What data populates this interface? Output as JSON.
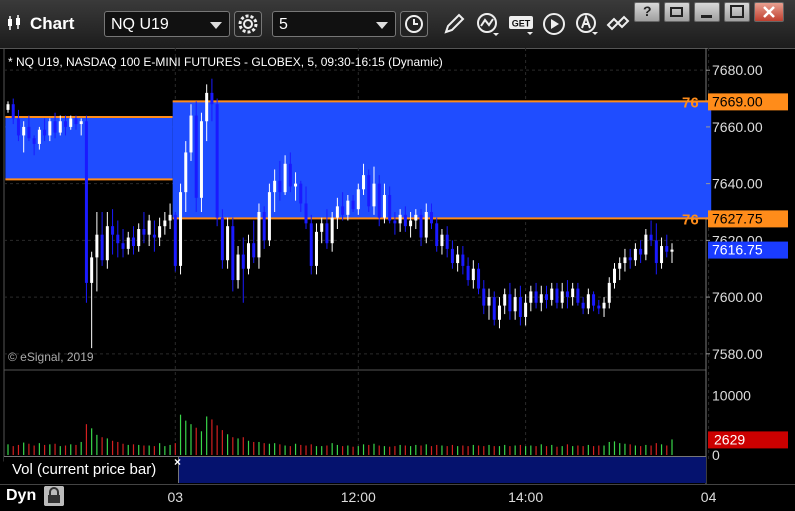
{
  "window": {
    "title": "Chart",
    "symbol_combo": "NQ U19",
    "interval_combo": "5",
    "buttons": [
      "clock-icon",
      "pencil-icon",
      "line-chart-icon",
      "get-icon",
      "play-icon",
      "alert-icon",
      "link-icon"
    ],
    "win_buttons": [
      "help",
      "restore",
      "maximize",
      "close"
    ],
    "help_label": "?"
  },
  "chart": {
    "symbol_line": "* NQ U19, NASDAQ 100 E-MINI FUTURES - GLOBEX, 5, 09:30-16:15 (Dynamic)",
    "copyright": "© eSignal, 2019",
    "dyn_label": "Dyn"
  },
  "volume": {
    "legend": "Vol (current price bar)",
    "close_glyph": "×"
  },
  "colors": {
    "zone": "#1f4dff",
    "zone_line": "#ff8c1a",
    "up": "#ffffff",
    "down": "#1a1aff",
    "vol_up": "#39d64a",
    "vol_down": "#d42020",
    "last_price_bg": "#1a3cff",
    "last_vol_bg": "#cc0000"
  },
  "chart_data": {
    "type": "candlestick",
    "price_axis": {
      "ylim": [
        7575,
        7685
      ],
      "ticks": [
        "7680.00",
        "7660.00",
        "7640.00",
        "7620.00",
        "7600.00",
        "7580.00"
      ],
      "labels": {
        "zone_upper": "7669.00",
        "zone_lower": "7627.75",
        "last": "7616.75",
        "zone_upper_left": "76",
        "zone_lower_left": "76"
      }
    },
    "volume_axis": {
      "ylim": [
        0,
        14000
      ],
      "ticks": [
        "10000",
        "0"
      ],
      "last_label": "2629"
    },
    "x_labels": [
      "03",
      "12:00",
      "14:00",
      "04"
    ],
    "zones": [
      {
        "from_bar": 0,
        "to_bar": 31,
        "top": 7663.5,
        "bottom": 7641.5
      },
      {
        "from_bar": 32,
        "to_bar": 134,
        "top": 7669.0,
        "bottom": 7627.75
      }
    ],
    "candles": [
      [
        7666,
        7669,
        7665,
        7668,
        1800
      ],
      [
        7668,
        7670,
        7661,
        7663,
        1500
      ],
      [
        7663,
        7666,
        7655,
        7657,
        1700
      ],
      [
        7657,
        7662,
        7651,
        7660,
        2100
      ],
      [
        7660,
        7664,
        7655,
        7656,
        1900
      ],
      [
        7656,
        7657,
        7650,
        7654,
        1600
      ],
      [
        7654,
        7660,
        7652,
        7659,
        2000
      ],
      [
        7659,
        7663,
        7655,
        7657,
        1700
      ],
      [
        7657,
        7663,
        7655,
        7662,
        1800
      ],
      [
        7662,
        7665,
        7656,
        7658,
        1900
      ],
      [
        7658,
        7664,
        7657,
        7662,
        1500
      ],
      [
        7662,
        7664,
        7657,
        7660,
        1600
      ],
      [
        7660,
        7664,
        7659,
        7663,
        1800
      ],
      [
        7663,
        7664,
        7659,
        7661,
        1700
      ],
      [
        7661,
        7663,
        7657,
        7662,
        2200
      ],
      [
        7662,
        7664,
        7598,
        7605,
        5200
      ],
      [
        7605,
        7616,
        7582,
        7614,
        4500
      ],
      [
        7614,
        7630,
        7602,
        7622,
        3400
      ],
      [
        7622,
        7630,
        7611,
        7613,
        3000
      ],
      [
        7613,
        7630,
        7610,
        7625,
        2800
      ],
      [
        7625,
        7631,
        7615,
        7622,
        2400
      ],
      [
        7622,
        7627,
        7614,
        7619,
        2200
      ],
      [
        7619,
        7624,
        7614,
        7617,
        1900
      ],
      [
        7617,
        7623,
        7615,
        7621,
        1700
      ],
      [
        7621,
        7625,
        7615,
        7618,
        1800
      ],
      [
        7618,
        7626,
        7616,
        7624,
        1700
      ],
      [
        7624,
        7630,
        7619,
        7622,
        1600
      ],
      [
        7622,
        7629,
        7618,
        7627,
        1600
      ],
      [
        7622,
        7627,
        7616,
        7621,
        1500
      ],
      [
        7621,
        7628,
        7618,
        7625,
        2000
      ],
      [
        7625,
        7630,
        7622,
        7627,
        1500
      ],
      [
        7627,
        7633,
        7624,
        7629,
        1700
      ],
      [
        7629,
        7630,
        7609,
        7611,
        2000
      ],
      [
        7611,
        7640,
        7608,
        7637,
        6800
      ],
      [
        7637,
        7655,
        7630,
        7651,
        5800
      ],
      [
        7651,
        7668,
        7648,
        7664,
        5200
      ],
      [
        7664,
        7669,
        7630,
        7635,
        4600
      ],
      [
        7635,
        7665,
        7630,
        7662,
        4000
      ],
      [
        7662,
        7675,
        7655,
        7672,
        6500
      ],
      [
        7672,
        7677,
        7662,
        7668,
        6000
      ],
      [
        7668,
        7670,
        7625,
        7628,
        5000
      ],
      [
        7628,
        7631,
        7610,
        7613,
        4200
      ],
      [
        7613,
        7628,
        7610,
        7625,
        3500
      ],
      [
        7625,
        7628,
        7602,
        7606,
        3000
      ],
      [
        7606,
        7618,
        7603,
        7615,
        2800
      ],
      [
        7615,
        7621,
        7598,
        7610,
        3000
      ],
      [
        7610,
        7622,
        7608,
        7619,
        2400
      ],
      [
        7619,
        7627,
        7612,
        7614,
        2200
      ],
      [
        7614,
        7633,
        7610,
        7630,
        2200
      ],
      [
        7630,
        7632,
        7617,
        7620,
        2000
      ],
      [
        7620,
        7640,
        7618,
        7637,
        1900
      ],
      [
        7637,
        7645,
        7630,
        7641,
        2000
      ],
      [
        7641,
        7648,
        7634,
        7637,
        1800
      ],
      [
        7637,
        7650,
        7636,
        7647,
        1600
      ],
      [
        7647,
        7651,
        7637,
        7639,
        1500
      ],
      [
        7639,
        7644,
        7634,
        7640,
        1900
      ],
      [
        7640,
        7641,
        7630,
        7633,
        1700
      ],
      [
        7633,
        7639,
        7624,
        7626,
        1600
      ],
      [
        7626,
        7629,
        7608,
        7611,
        1800
      ],
      [
        7611,
        7626,
        7608,
        7623,
        1500
      ],
      [
        7623,
        7628,
        7619,
        7626,
        1500
      ],
      [
        7626,
        7631,
        7617,
        7619,
        1600
      ],
      [
        7619,
        7630,
        7616,
        7628,
        2000
      ],
      [
        7628,
        7635,
        7624,
        7632,
        1700
      ],
      [
        7632,
        7637,
        7627,
        7629,
        1500
      ],
      [
        7629,
        7636,
        7627,
        7634,
        1600
      ],
      [
        7634,
        7636,
        7630,
        7631,
        1400
      ],
      [
        7631,
        7640,
        7629,
        7638,
        1500
      ],
      [
        7638,
        7647,
        7636,
        7643,
        1800
      ],
      [
        7643,
        7645,
        7630,
        7632,
        1700
      ],
      [
        7632,
        7646,
        7629,
        7640,
        1900
      ],
      [
        7640,
        7643,
        7625,
        7628,
        1600
      ],
      [
        7628,
        7640,
        7626,
        7636,
        1500
      ],
      [
        7636,
        7639,
        7626,
        7627,
        1400
      ],
      [
        7627,
        7630,
        7622,
        7626,
        1500
      ],
      [
        7626,
        7631,
        7623,
        7629,
        1700
      ],
      [
        7629,
        7632,
        7623,
        7625,
        1600
      ],
      [
        7625,
        7630,
        7621,
        7627,
        1500
      ],
      [
        7627,
        7631,
        7624,
        7629,
        1700
      ],
      [
        7629,
        7631,
        7618,
        7621,
        1600
      ],
      [
        7621,
        7633,
        7619,
        7630,
        1800
      ],
      [
        7630,
        7633,
        7624,
        7626,
        1500
      ],
      [
        7626,
        7628,
        7616,
        7618,
        1700
      ],
      [
        7618,
        7624,
        7615,
        7622,
        1600
      ],
      [
        7622,
        7625,
        7614,
        7617,
        1500
      ],
      [
        7617,
        7620,
        7610,
        7612,
        1700
      ],
      [
        7612,
        7618,
        7609,
        7615,
        1500
      ],
      [
        7615,
        7618,
        7608,
        7611,
        1600
      ],
      [
        7611,
        7614,
        7604,
        7606,
        1500
      ],
      [
        7606,
        7613,
        7603,
        7610,
        1700
      ],
      [
        7610,
        7612,
        7601,
        7603,
        1600
      ],
      [
        7603,
        7606,
        7594,
        7597,
        1500
      ],
      [
        7597,
        7603,
        7592,
        7600,
        1700
      ],
      [
        7600,
        7602,
        7590,
        7592,
        1500
      ],
      [
        7592,
        7600,
        7589,
        7597,
        1500
      ],
      [
        7597,
        7603,
        7594,
        7601,
        1700
      ],
      [
        7601,
        7605,
        7592,
        7595,
        1500
      ],
      [
        7595,
        7603,
        7592,
        7600,
        1600
      ],
      [
        7600,
        7604,
        7590,
        7593,
        1700
      ],
      [
        7593,
        7601,
        7590,
        7598,
        1500
      ],
      [
        7598,
        7604,
        7595,
        7602,
        1600
      ],
      [
        7602,
        7605,
        7596,
        7598,
        1500
      ],
      [
        7598,
        7604,
        7595,
        7601,
        1800
      ],
      [
        7601,
        7604,
        7596,
        7599,
        1500
      ],
      [
        7599,
        7605,
        7597,
        7603,
        1700
      ],
      [
        7603,
        7605,
        7596,
        7598,
        1400
      ],
      [
        7598,
        7605,
        7596,
        7602,
        1500
      ],
      [
        7602,
        7606,
        7596,
        7600,
        1800
      ],
      [
        7600,
        7605,
        7597,
        7603,
        1500
      ],
      [
        7603,
        7605,
        7597,
        7598,
        1600
      ],
      [
        7598,
        7600,
        7594,
        7596,
        1500
      ],
      [
        7596,
        7603,
        7594,
        7601,
        1700
      ],
      [
        7601,
        7602,
        7595,
        7597,
        1500
      ],
      [
        7597,
        7599,
        7594,
        7596,
        1600
      ],
      [
        7596,
        7600,
        7593,
        7598,
        1600
      ],
      [
        7598,
        7607,
        7596,
        7605,
        2200
      ],
      [
        7605,
        7612,
        7603,
        7610,
        2300
      ],
      [
        7610,
        7614,
        7606,
        7612,
        2000
      ],
      [
        7612,
        7617,
        7609,
        7614,
        1900
      ],
      [
        7614,
        7617,
        7610,
        7613,
        1800
      ],
      [
        7613,
        7619,
        7611,
        7617,
        1600
      ],
      [
        7617,
        7620,
        7612,
        7615,
        1500
      ],
      [
        7615,
        7624,
        7613,
        7622,
        1700
      ],
      [
        7622,
        7627,
        7618,
        7620,
        1600
      ],
      [
        7620,
        7626,
        7608,
        7612,
        2000
      ],
      [
        7612,
        7621,
        7610,
        7618,
        1800
      ],
      [
        7618,
        7622,
        7614,
        7616,
        1600
      ],
      [
        7616,
        7619,
        7612,
        7616.75,
        2629
      ]
    ]
  }
}
